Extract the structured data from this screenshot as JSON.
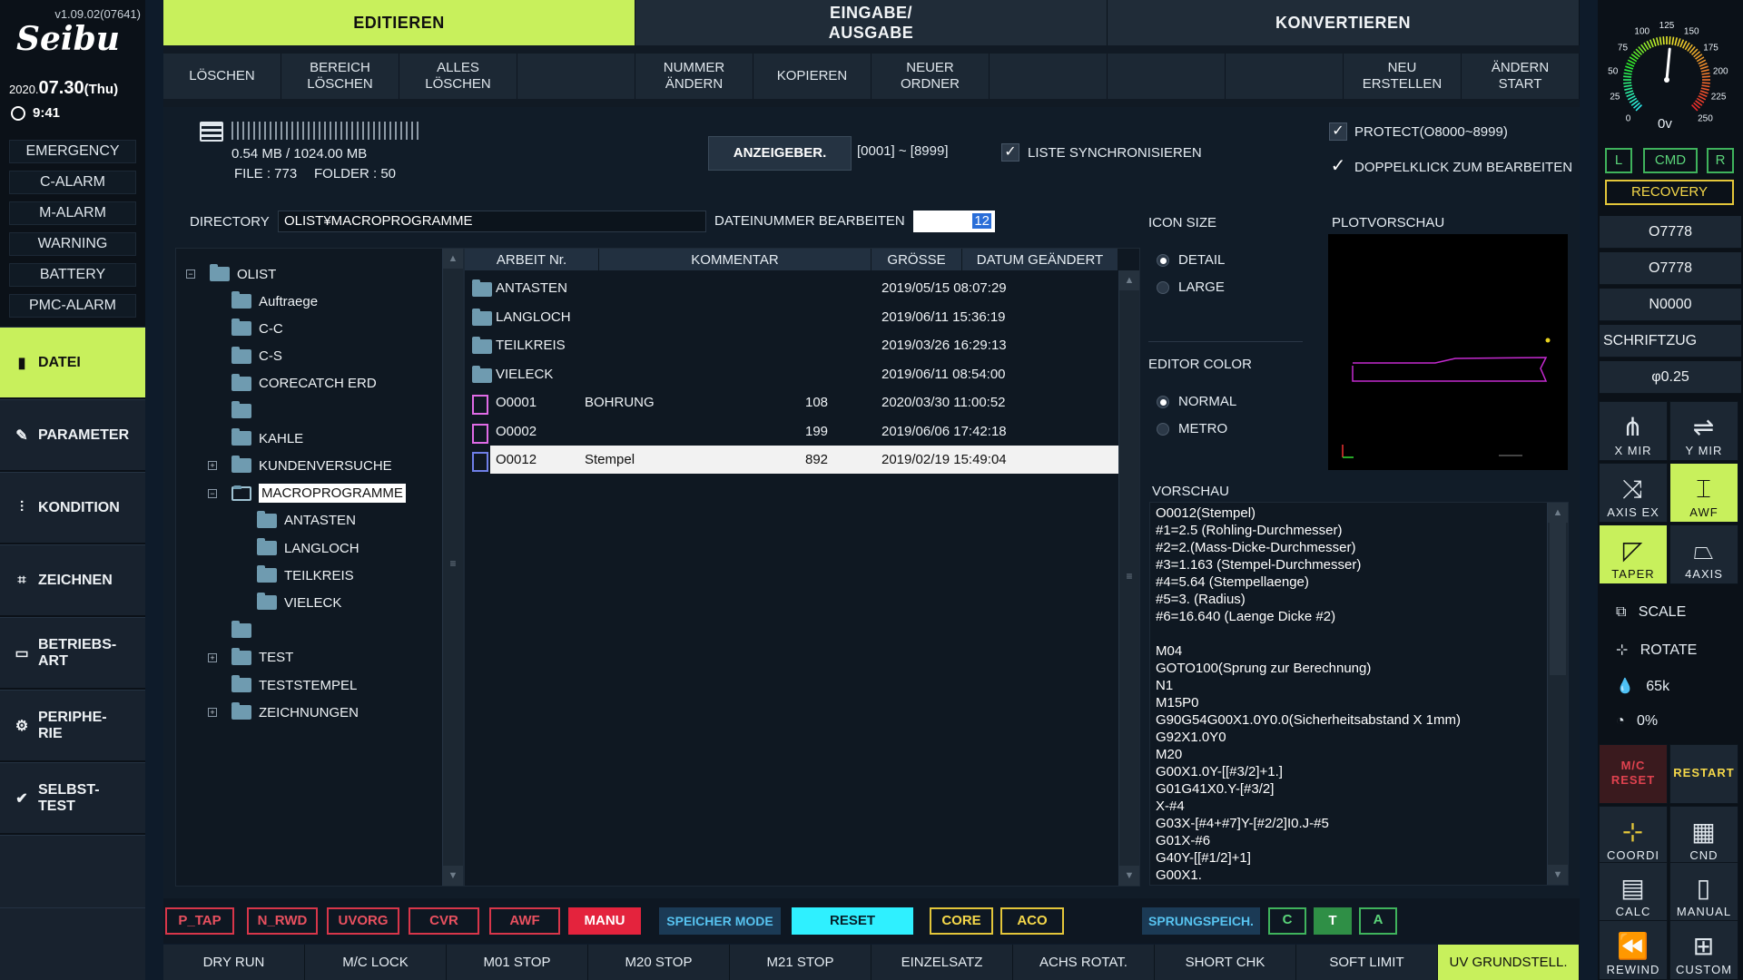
{
  "sidebar": {
    "version": "v1.09.02(07641)",
    "logo": "Seibu",
    "date_year": "2020.",
    "date_main": "07.30",
    "date_day": "(Thu)",
    "time": "9:41",
    "alarms": [
      "EMERGENCY",
      "C-ALARM",
      "M-ALARM",
      "WARNING",
      "BATTERY",
      "PMC-ALARM"
    ],
    "nav": [
      {
        "label": "DATEI",
        "icon": "file-icon"
      },
      {
        "label": "PARAMETER",
        "icon": "wrench-icon"
      },
      {
        "label": "KONDITION",
        "icon": "sliders-icon"
      },
      {
        "label": "ZEICHNEN",
        "icon": "drawing-icon"
      },
      {
        "label1": "BETRIEBS-",
        "label2": "ART",
        "icon": "monitor-icon"
      },
      {
        "label1": "PERIPHE-",
        "label2": "RIE",
        "icon": "gear-icon"
      },
      {
        "label1": "SELBST-",
        "label2": "TEST",
        "icon": "check-icon"
      }
    ]
  },
  "tabs": {
    "edit": "EDITIEREN",
    "io1": "EINGABE/",
    "io2": "AUSGABE",
    "convert": "KONVERTIEREN"
  },
  "subtoolbar": {
    "delete": "LÖSCHEN",
    "range_delete1": "BEREICH",
    "range_delete2": "LÖSCHEN",
    "all_delete1": "ALLES",
    "all_delete2": "LÖSCHEN",
    "renumber1": "NUMMER",
    "renumber2": "ÄNDERN",
    "copy": "KOPIEREN",
    "new_folder1": "NEUER",
    "new_folder2": "ORDNER",
    "create1": "NEU",
    "create2": "ERSTELLEN",
    "change_start1": "ÄNDERN",
    "change_start2": "START"
  },
  "storage": {
    "used": "0.54 MB / 1024.00 MB",
    "files": "FILE : 773",
    "folders": "FOLDER : 50",
    "display_range_btn": "ANZEIGEBER.",
    "range": "[0001] ~ [8999]",
    "sync_label": "LISTE SYNCHRONISIEREN",
    "protect_label": "PROTECT(O8000~8999)",
    "dblclick_label": "DOPPELKLICK ZUM BEARBEITEN"
  },
  "directory": {
    "label": "DIRECTORY",
    "path": "OLIST¥MACROPROGRAMME",
    "edit_num_label": "DATEINUMMER BEARBEITEN",
    "edit_num_value": "12"
  },
  "tree": [
    {
      "label": "OLIST",
      "level": 0,
      "pm": "−"
    },
    {
      "label": "Auftraege",
      "level": 1
    },
    {
      "label": "C-C",
      "level": 1
    },
    {
      "label": "C-S",
      "level": 1
    },
    {
      "label": "CORECATCH ERD",
      "level": 1
    },
    {
      "label": "",
      "level": 1
    },
    {
      "label": "KAHLE",
      "level": 1
    },
    {
      "label": "KUNDENVERSUCHE",
      "level": 1,
      "pm": "+"
    },
    {
      "label": "MACROPROGRAMME",
      "level": 1,
      "pm": "−",
      "selected": true
    },
    {
      "label": "ANTASTEN",
      "level": 2
    },
    {
      "label": "LANGLOCH",
      "level": 2
    },
    {
      "label": "TEILKREIS",
      "level": 2
    },
    {
      "label": "VIELECK",
      "level": 2
    },
    {
      "label": "",
      "level": 1
    },
    {
      "label": "TEST",
      "level": 1,
      "pm": "+"
    },
    {
      "label": "TESTSTEMPEL",
      "level": 1
    },
    {
      "label": "ZEICHNUNGEN",
      "level": 1,
      "pm": "+"
    }
  ],
  "filetable": {
    "headers": [
      "ARBEIT Nr.",
      "KOMMENTAR",
      "GRÖSSE",
      "DATUM GEÄNDERT"
    ],
    "rows": [
      {
        "type": "folder",
        "name": "ANTASTEN",
        "comment": "",
        "size": "",
        "date": "2019/05/15 08:07:29"
      },
      {
        "type": "folder",
        "name": "LANGLOCH",
        "comment": "",
        "size": "",
        "date": "2019/06/11 15:36:19"
      },
      {
        "type": "folder",
        "name": "TEILKREIS",
        "comment": "",
        "size": "",
        "date": "2019/03/26 16:29:13"
      },
      {
        "type": "folder",
        "name": "VIELECK",
        "comment": "",
        "size": "",
        "date": "2019/06/11 08:54:00"
      },
      {
        "type": "file",
        "name": "O0001",
        "comment": "BOHRUNG",
        "size": "108",
        "date": "2020/03/30 11:00:52"
      },
      {
        "type": "file",
        "name": "O0002",
        "comment": "",
        "size": "199",
        "date": "2019/06/06 17:42:18"
      },
      {
        "type": "file",
        "name": "O0012",
        "comment": "Stempel",
        "size": "892",
        "date": "2019/02/19 15:49:04",
        "selected": true
      }
    ]
  },
  "options": {
    "icon_size_label": "ICON SIZE",
    "detail": "DETAIL",
    "large": "LARGE",
    "editor_color_label": "EDITOR COLOR",
    "normal": "NORMAL",
    "metro": "METRO",
    "plot_label": "PLOTVORSCHAU",
    "preview_label": "VORSCHAU"
  },
  "preview_lines": [
    "O0012(Stempel)",
    "#1=2.5 (Rohling-Durchmesser)",
    "#2=2.(Mass-Dicke-Durchmesser)",
    "#3=1.163 (Stempel-Durchmesser)",
    "#4=5.64 (Stempellaenge)",
    "#5=3. (Radius)",
    "#6=16.640 (Laenge Dicke #2)",
    "",
    "M04",
    "GOTO100(Sprung zur Berechnung)",
    "N1",
    "M15P0",
    "G90G54G00X1.0Y0.0(Sicherheitsabstand X 1mm)",
    "G92X1.0Y0",
    "M20",
    "G00X1.0Y-[[#3/2]+1.]",
    "G01G41X0.Y-[#3/2]",
    "X-#4",
    "G03X-[#4+#7]Y-[#2/2]I0.J-#5",
    "G01X-#6",
    "G40Y-[[#1/2]+1]",
    "G00X1."
  ],
  "modes": {
    "p_tap": "P_TAP",
    "n_rwd": "N_RWD",
    "uvorg": "UVORG",
    "cvr": "CVR",
    "awf": "AWF",
    "manu": "MANU",
    "speicher": "SPEICHER MODE",
    "reset": "RESET",
    "core": "CORE",
    "aco": "ACO",
    "sprung": "SPRUNGSPEICH.",
    "c": "C",
    "t": "T",
    "a": "A"
  },
  "functions": [
    "DRY RUN",
    "M/C LOCK",
    "M01 STOP",
    "M20 STOP",
    "M21 STOP",
    "EINZELSATZ",
    "ACHS ROTAT.",
    "SHORT CHK",
    "SOFT LIMIT",
    "UV GRUNDSTELL."
  ],
  "right": {
    "gauge_ticks": [
      "0",
      "25",
      "50",
      "75",
      "100",
      "125",
      "150",
      "175",
      "200",
      "225",
      "250"
    ],
    "gauge_value_label": "0v",
    "gauge_value": 0.52,
    "l": "L",
    "cmd": "CMD",
    "r": "R",
    "recovery": "RECOVERY",
    "prog1": "O7778",
    "prog2": "O7778",
    "seq": "N0000",
    "font": "SCHRIFTZUG",
    "wire": "φ0.25",
    "xmir": "X MIR",
    "ymir": "Y MIR",
    "axisex": "AXIS EX",
    "awf": "AWF",
    "taper": "TAPER",
    "fouraxis": "4AXIS",
    "scale": "SCALE",
    "rotate": "ROTATE",
    "speed": "65k",
    "percent": "0%",
    "mcreset1": "M/C",
    "mcreset2": "RESET",
    "restart": "RESTART",
    "coordi": "COORDI",
    "cnd": "CND",
    "calc": "CALC",
    "manual": "MANUAL",
    "rewind": "REWIND",
    "custom": "CUSTOM"
  },
  "colors": {
    "accent": "#c8f05c",
    "alarm_red": "#d8364a",
    "cyan": "#2ff0ff",
    "yellow": "#e3c63a",
    "green": "#3fb35c"
  }
}
